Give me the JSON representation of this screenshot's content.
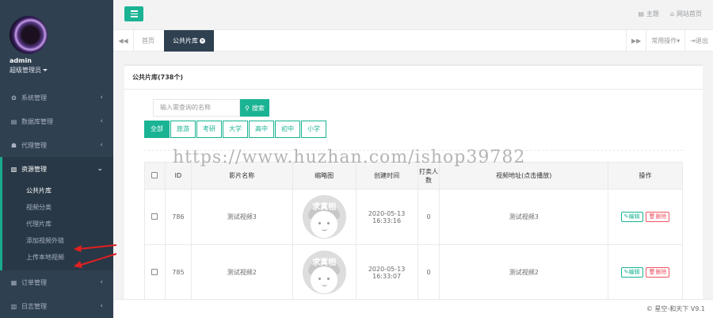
{
  "sidebar": {
    "user": {
      "name": "admin",
      "role": "超级管理员"
    },
    "items": [
      {
        "label": "系统管理",
        "icon": "gear-icon"
      },
      {
        "label": "数据库管理",
        "icon": "database-icon"
      },
      {
        "label": "代理管理",
        "icon": "users-icon"
      },
      {
        "label": "资源管理",
        "icon": "file-icon",
        "active": true
      },
      {
        "label": "订单管理",
        "icon": "list-icon"
      },
      {
        "label": "日志管理",
        "icon": "log-icon"
      }
    ],
    "subitems": [
      "公共片库",
      "视频分类",
      "代理片库",
      "添加视频外链",
      "上传本地视频"
    ]
  },
  "topbar": {
    "theme_label": "主题",
    "site_home_label": "网站首页"
  },
  "tabs": {
    "home": "首页",
    "current": "公共片库",
    "common_ops": "常用操作",
    "logout": "退出"
  },
  "panel": {
    "title": "公共片库(738个)",
    "search_placeholder": "输入需查询的名称",
    "search_button": "搜索",
    "filters": [
      "全部",
      "旅游",
      "考研",
      "大学",
      "高中",
      "初中",
      "小学"
    ]
  },
  "table": {
    "headers": [
      "ID",
      "影片名称",
      "缩略图",
      "创建时间",
      "打卖人数",
      "视频地址(点击播放)",
      "操作"
    ],
    "rows": [
      {
        "id": "786",
        "name": "测试视频3",
        "thumb_text": "求真相",
        "date": "2020-05-13",
        "time": "16:33:16",
        "count": "0",
        "url": "测试视频3"
      },
      {
        "id": "785",
        "name": "测试视频2",
        "thumb_text": "求真相",
        "date": "2020-05-13",
        "time": "16:33:07",
        "count": "0",
        "url": "测试视频2"
      }
    ],
    "edit_label": "编辑",
    "delete_label": "删除"
  },
  "footer": {
    "text": "© 星空-和天下 V9.1"
  },
  "watermark": "https://www.huzhan.com/ishop39782",
  "colors": {
    "sidebar": "#2f4050",
    "accent": "#1ab394",
    "danger": "#ed5565"
  }
}
